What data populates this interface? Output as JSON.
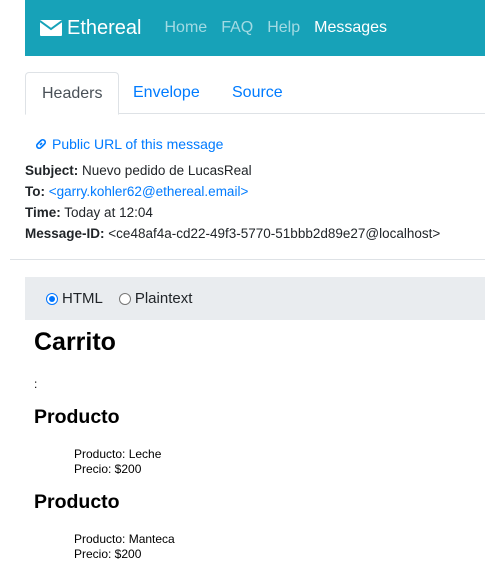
{
  "brand": {
    "name": "Ethereal"
  },
  "nav": {
    "items": [
      "Home",
      "FAQ",
      "Help",
      "Messages"
    ],
    "active": "Messages"
  },
  "tabs": {
    "items": [
      "Headers",
      "Envelope",
      "Source"
    ],
    "active": "Headers"
  },
  "headers": {
    "public_url": "Public URL of this message",
    "subject_label": "Subject:",
    "subject": "Nuevo pedido de LucasReal",
    "to_label": "To:",
    "to": "<garry.kohler62@ethereal.email>",
    "time_label": "Time:",
    "time": "Today at 12:04",
    "message_id_label": "Message-ID:",
    "message_id": "<ce48af4a-cd22-49f3-5770-51bbb2d89e27@localhost>"
  },
  "view": {
    "html_label": "HTML",
    "plaintext_label": "Plaintext",
    "selected": "HTML"
  },
  "email_body": {
    "title": "Carrito",
    "colon": ":",
    "products": [
      {
        "heading": "Producto",
        "name_line": "Producto: Leche",
        "price_line": "Precio: $200"
      },
      {
        "heading": "Producto",
        "name_line": "Producto: Manteca",
        "price_line": "Precio: $200"
      }
    ]
  },
  "colors": {
    "navbar": "#17a2b8",
    "link": "#007bff",
    "view_bar": "#e9ecef"
  }
}
